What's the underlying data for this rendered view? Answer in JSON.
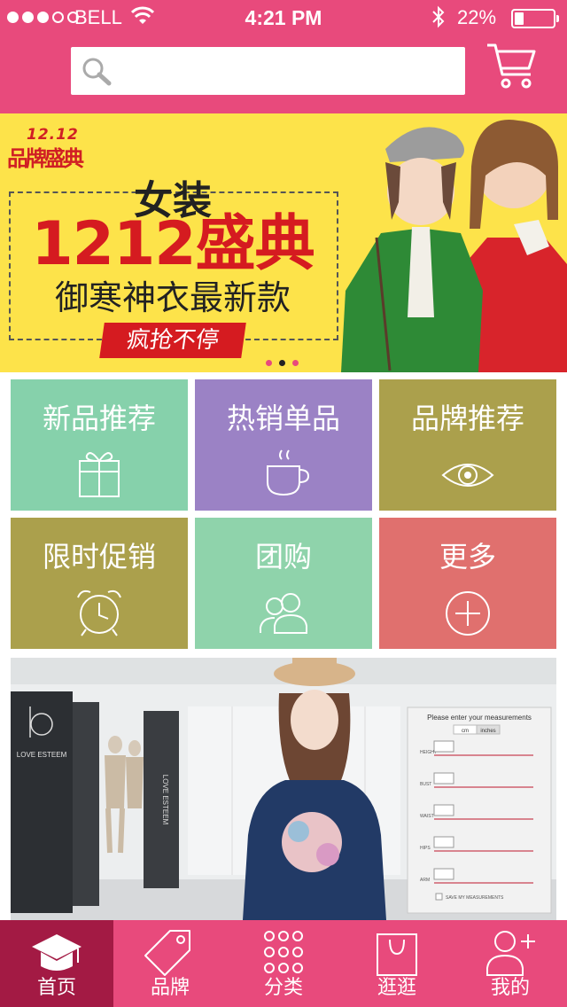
{
  "status_bar": {
    "carrier": "BELL",
    "time": "4:21 PM",
    "battery": "22%",
    "battery_level": 0.22
  },
  "search": {
    "placeholder": "",
    "value": ""
  },
  "banner": {
    "logo_year": "12.12",
    "logo_name": "品牌盛典",
    "title": "女装",
    "headline": "1212盛典",
    "subtitle": "御寒神衣最新款",
    "tag": "疯抢不停",
    "pager": {
      "count": 3,
      "active_index": 1
    }
  },
  "tiles": [
    {
      "label": "新品推荐",
      "icon": "gift-icon",
      "color": "#86d1ab"
    },
    {
      "label": "热销单品",
      "icon": "coffee-cup-icon",
      "color": "#9b82c5"
    },
    {
      "label": "品牌推荐",
      "icon": "eye-icon",
      "color": "#aba04c"
    },
    {
      "label": "限时促销",
      "icon": "alarm-clock-icon",
      "color": "#aba04c"
    },
    {
      "label": "团购",
      "icon": "group-icon",
      "color": "#8fd3ab"
    },
    {
      "label": "更多",
      "icon": "plus-circle-icon",
      "color": "#e0706e"
    }
  ],
  "promo": {
    "brand_name": "LOVE ESTEEM",
    "wall_text": "LOVE ESTEEM",
    "panel_title": "Please enter your measurements",
    "units": [
      "cm",
      "inches"
    ],
    "measurements": [
      "HEIGHT",
      "BUST",
      "WAIST",
      "HIPS",
      "ARM"
    ],
    "save_label": "SAVE MY MEASUREMENTS"
  },
  "tabbar": [
    {
      "label": "首页",
      "icon": "graduation-cap-icon",
      "active": true
    },
    {
      "label": "品牌",
      "icon": "price-tag-icon",
      "active": false
    },
    {
      "label": "分类",
      "icon": "grid-dots-icon",
      "active": false
    },
    {
      "label": "逛逛",
      "icon": "shopping-bag-icon",
      "active": false
    },
    {
      "label": "我的",
      "icon": "user-add-icon",
      "active": false
    }
  ],
  "colors": {
    "brand_pink": "#e84a7c",
    "tab_active": "#a31a44",
    "banner_yellow": "#fde34a",
    "banner_red": "#d51b20"
  }
}
